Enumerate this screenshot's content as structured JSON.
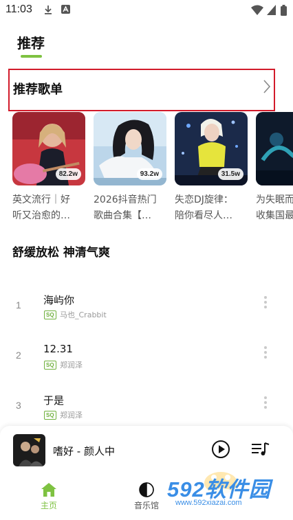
{
  "status_bar": {
    "time": "11:03"
  },
  "header": {
    "title": "推荐"
  },
  "recommend_section": {
    "title": "推荐歌单"
  },
  "playlists": [
    {
      "title": "英文流行｜好\n听又治愈的…",
      "count": "82.2w"
    },
    {
      "title": "2026抖音热门\n歌曲合集【…",
      "count": "93.2w"
    },
    {
      "title": "失恋DJ旋律：\n陪你看尽人…",
      "count": "31.5w"
    },
    {
      "title": "为失眠而\n收集国最",
      "count": ""
    }
  ],
  "mood_section": {
    "title": "舒缓放松 神清气爽"
  },
  "songs": [
    {
      "rank": "1",
      "title": "海屿你",
      "quality": "SQ",
      "artist": "马也_Crabbit"
    },
    {
      "rank": "2",
      "title": "12.31",
      "quality": "SQ",
      "artist": "郑润泽"
    },
    {
      "rank": "3",
      "title": "于是",
      "quality": "SQ",
      "artist": "郑润泽"
    }
  ],
  "mini_player": {
    "title": "嗜好 - 颜人中"
  },
  "bottom_nav": [
    {
      "label": "主页",
      "icon": "home-icon",
      "active": true
    },
    {
      "label": "音乐馆",
      "icon": "music-hall-icon",
      "active": false
    }
  ],
  "watermark": {
    "logo": "592软件园",
    "url": "www.592xiazai.com"
  },
  "colors": {
    "accent": "#7ec241",
    "highlight_box": "#d21a2a",
    "watermark": "#3a8ee6"
  }
}
